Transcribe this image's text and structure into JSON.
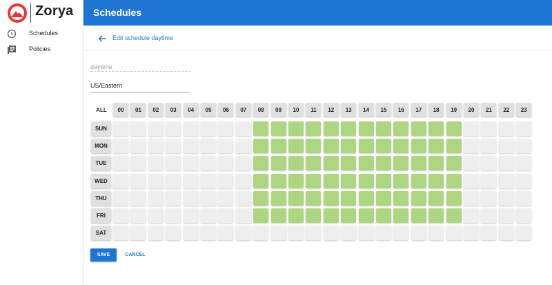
{
  "app": {
    "name": "Zorya",
    "logo_color": "#e53935"
  },
  "sidebar": {
    "items": [
      {
        "label": "Schedules",
        "icon": "clock-icon"
      },
      {
        "label": "Policies",
        "icon": "library-books-icon"
      }
    ]
  },
  "header": {
    "title": "Schedules"
  },
  "page": {
    "back_label": "Edit schedule daytime",
    "name_placeholder": "daytime",
    "timezone_value": "US/Eastern"
  },
  "grid": {
    "all_label": "ALL",
    "hours": [
      "00",
      "01",
      "02",
      "03",
      "04",
      "05",
      "06",
      "07",
      "08",
      "09",
      "10",
      "11",
      "12",
      "13",
      "14",
      "15",
      "16",
      "17",
      "18",
      "19",
      "20",
      "21",
      "22",
      "23"
    ],
    "days": [
      "SUN",
      "MON",
      "TUE",
      "WED",
      "THU",
      "FRI",
      "SAT"
    ],
    "active": [
      [
        0,
        0,
        0,
        0,
        0,
        0,
        0,
        0,
        1,
        1,
        1,
        1,
        1,
        1,
        1,
        1,
        1,
        1,
        1,
        1,
        0,
        0,
        0,
        0
      ],
      [
        0,
        0,
        0,
        0,
        0,
        0,
        0,
        0,
        1,
        1,
        1,
        1,
        1,
        1,
        1,
        1,
        1,
        1,
        1,
        1,
        0,
        0,
        0,
        0
      ],
      [
        0,
        0,
        0,
        0,
        0,
        0,
        0,
        0,
        1,
        1,
        1,
        1,
        1,
        1,
        1,
        1,
        1,
        1,
        1,
        1,
        0,
        0,
        0,
        0
      ],
      [
        0,
        0,
        0,
        0,
        0,
        0,
        0,
        0,
        1,
        1,
        1,
        1,
        1,
        1,
        1,
        1,
        1,
        1,
        1,
        1,
        0,
        0,
        0,
        0
      ],
      [
        0,
        0,
        0,
        0,
        0,
        0,
        0,
        0,
        1,
        1,
        1,
        1,
        1,
        1,
        1,
        1,
        1,
        1,
        1,
        1,
        0,
        0,
        0,
        0
      ],
      [
        0,
        0,
        0,
        0,
        0,
        0,
        0,
        0,
        1,
        1,
        1,
        1,
        1,
        1,
        1,
        1,
        1,
        1,
        1,
        1,
        0,
        0,
        0,
        0
      ],
      [
        0,
        0,
        0,
        0,
        0,
        0,
        0,
        0,
        0,
        0,
        0,
        0,
        0,
        0,
        0,
        0,
        0,
        0,
        0,
        0,
        0,
        0,
        0,
        0
      ]
    ],
    "active_color": "#aed581",
    "inactive_color": "#eeeeee"
  },
  "actions": {
    "save_label": "SAVE",
    "cancel_label": "CANCEL"
  },
  "colors": {
    "primary": "#1f76d2"
  }
}
